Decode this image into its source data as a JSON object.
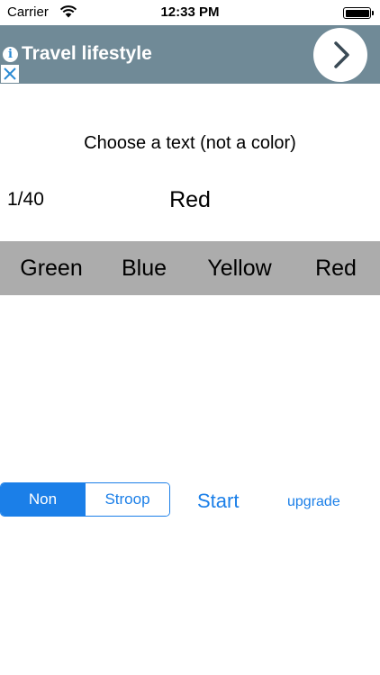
{
  "status_bar": {
    "carrier": "Carrier",
    "time": "12:33 PM",
    "wifi_icon": "wifi-icon",
    "battery_icon": "battery-icon"
  },
  "ad": {
    "title": "Travel lifestyle",
    "info_icon": "info-icon",
    "close_icon": "close-icon",
    "arrow_icon": "chevron-right-icon",
    "background_color": "#708a97",
    "title_color": "#ffffff"
  },
  "main": {
    "instruction": "Choose a text (not a color)",
    "progress": "1/40",
    "prompt_word": "Red"
  },
  "answers": [
    "Green",
    "Blue",
    "Yellow",
    "Red"
  ],
  "controls": {
    "mode_options": [
      "Non",
      "Stroop"
    ],
    "selected_mode": "Non",
    "start_label": "Start",
    "upgrade_label": "upgrade"
  },
  "colors": {
    "accent": "#1b7fe8",
    "answer_bar_background": "#acacac"
  }
}
